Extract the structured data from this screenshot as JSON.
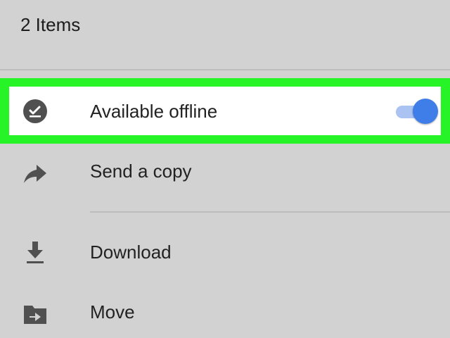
{
  "header": {
    "title": "2 Items"
  },
  "menu": {
    "items": [
      {
        "label": "Available offline",
        "icon": "offline-check-icon",
        "toggle_on": true
      },
      {
        "label": "Send a copy",
        "icon": "share-arrow-icon"
      },
      {
        "label": "Download",
        "icon": "download-icon"
      },
      {
        "label": "Move",
        "icon": "move-folder-icon"
      }
    ]
  },
  "colors": {
    "background": "#d2d2d2",
    "highlight": "#27f427",
    "toggle_thumb": "#3f7ee8",
    "toggle_track": "#aac3f3",
    "icon": "#505050"
  }
}
